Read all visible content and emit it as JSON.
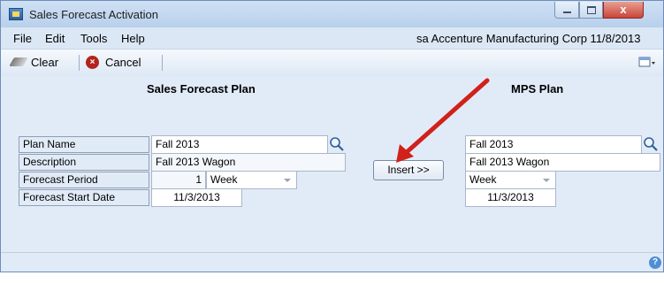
{
  "window": {
    "title": "Sales Forecast Activation"
  },
  "window_controls": {
    "close_glyph": "x"
  },
  "menu": {
    "items": [
      "File",
      "Edit",
      "Tools",
      "Help"
    ]
  },
  "header_info": "sa  Accenture Manufacturing Corp  11/8/2013",
  "toolbar": {
    "clear_label": "Clear",
    "cancel_label": "Cancel",
    "cancel_glyph": "×"
  },
  "sales_forecast_plan": {
    "heading": "Sales Forecast Plan",
    "labels": {
      "plan_name": "Plan Name",
      "description": "Description",
      "forecast_period": "Forecast Period",
      "start_date": "Forecast Start Date"
    },
    "values": {
      "plan_name": "Fall 2013",
      "description": "Fall 2013 Wagon",
      "period_count": "1",
      "period_unit": "Week",
      "start_date": "11/3/2013"
    }
  },
  "insert_button": {
    "label": "Insert >>"
  },
  "mps_plan": {
    "heading": "MPS Plan",
    "values": {
      "plan_name": "Fall 2013",
      "description": "Fall 2013 Wagon",
      "period_unit": "Week",
      "start_date": "11/3/2013"
    }
  },
  "help_glyph": "?",
  "colors": {
    "annotation_arrow": "#d0211b",
    "accent": "#4f8ed4"
  }
}
